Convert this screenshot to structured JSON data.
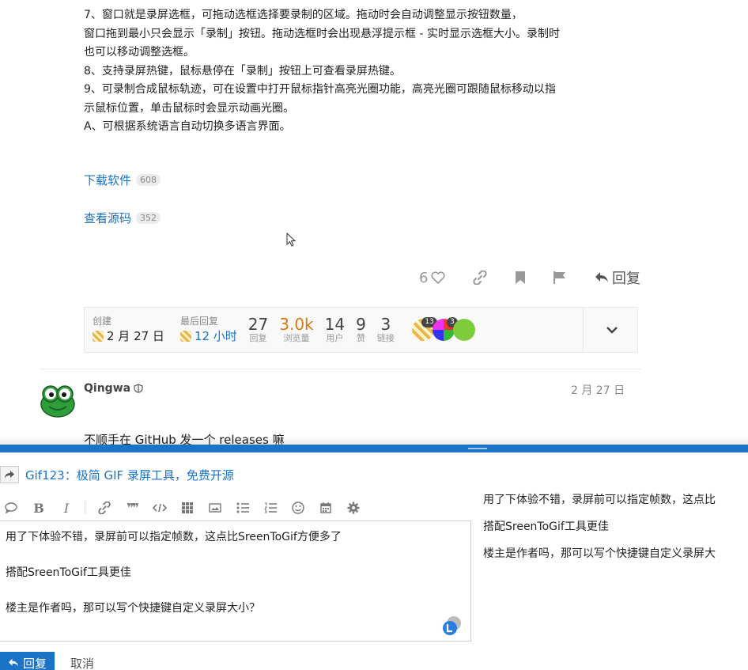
{
  "post": {
    "lines": [
      "7、窗口就是录屏选框，可拖动选框选择要录制的区域。拖动时会自动调整显示按钮数量，",
      "窗口拖到最小只会显示「录制」按钮。拖动选框时会出现悬浮提示框 - 实时显示选框大小。录制时",
      "也可以移动调整选框。",
      "8、支持录屏热键，鼠标悬停在「录制」按钮上可查看录屏热键。",
      "9、可录制合成鼠标轨迹，可在设置中打开鼠标指针高亮光圈功能，高亮光圈可跟随鼠标移动以指",
      "示鼠标位置，单击鼠标时会显示动画光圈。",
      "A、可根据系统语言自动切换多语言界面。"
    ],
    "links": [
      {
        "label": "下载软件",
        "clicks": "608"
      },
      {
        "label": "查看源码",
        "clicks": "352"
      }
    ],
    "actions": {
      "like_count": "6",
      "reply_label": "回复"
    }
  },
  "topic_map": {
    "created_label": "创建",
    "created_value": "2 月 27 日",
    "last_reply_label": "最后回复",
    "last_reply_value": "12 小时",
    "stats": [
      {
        "num": "27",
        "label": "回复"
      },
      {
        "num": "3.0k",
        "label": "浏览量"
      },
      {
        "num": "14",
        "label": "用户"
      },
      {
        "num": "9",
        "label": "赞"
      },
      {
        "num": "3",
        "label": "链接"
      }
    ],
    "avatar_badges": [
      "13",
      "3"
    ]
  },
  "reply": {
    "username": "Qingwa",
    "date": "2 月 27 日",
    "text": "不顺手在 GitHub 发一个 releases 嘛"
  },
  "composer": {
    "topic_title": "Gif123：极简 GIF 录屏工具，免费开源",
    "editor_lines": [
      "用了下体验不错，录屏前可以指定帧数，这点比SreenToGif方便多了",
      "搭配SreenToGif工具更佳",
      "楼主是作者吗，那可以写个快捷键自定义录屏大小？"
    ],
    "preview_lines": [
      "用了下体验不错，录屏前可以指定帧数，这点比",
      "搭配SreenToGif工具更佳",
      "楼主是作者吗，那可以写个快捷键自定义录屏大"
    ],
    "toolbar": {
      "bold": "B",
      "italic": "I",
      "quote": "❞❞"
    },
    "submit_label": "回复",
    "cancel_label": "取消"
  },
  "colors": {
    "accent": "#1a73c7",
    "views_highlight": "#d87a10"
  }
}
